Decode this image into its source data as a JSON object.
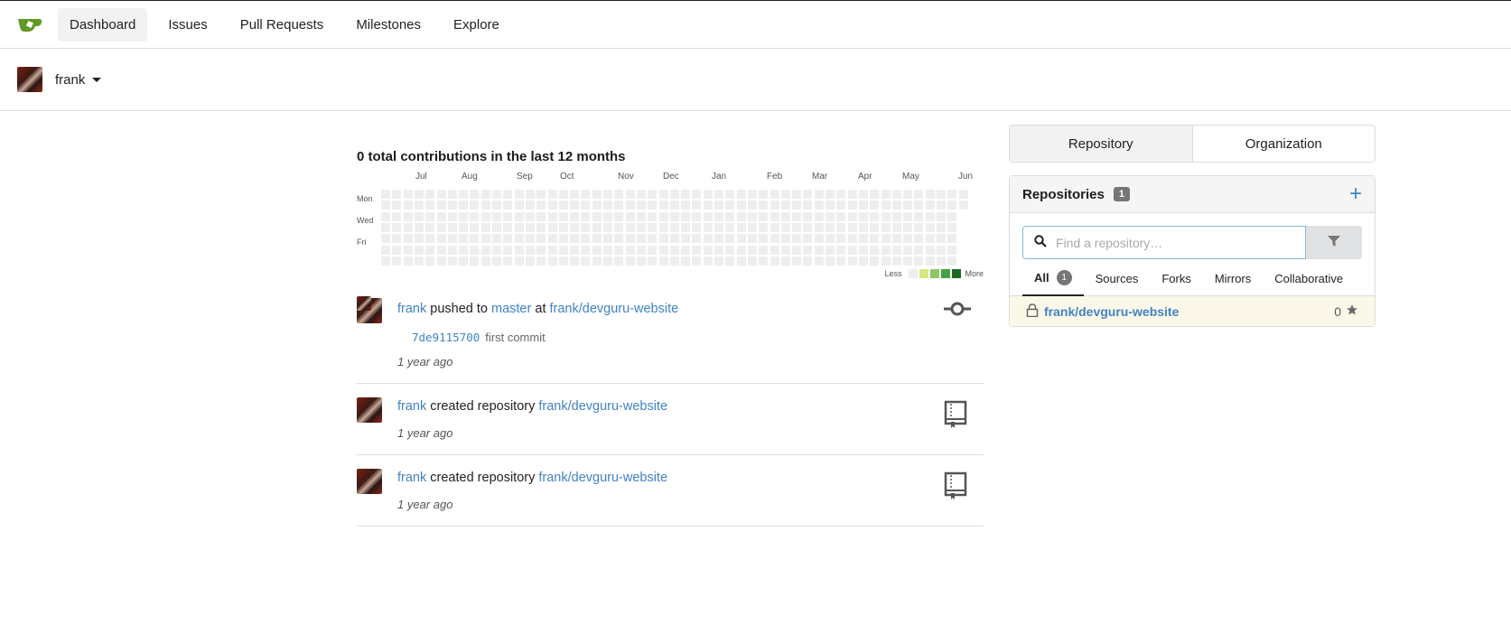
{
  "nav": {
    "items": [
      {
        "label": "Dashboard",
        "active": true
      },
      {
        "label": "Issues"
      },
      {
        "label": "Pull Requests"
      },
      {
        "label": "Milestones"
      },
      {
        "label": "Explore"
      }
    ]
  },
  "user": {
    "name": "frank"
  },
  "contributions": {
    "title": "0 total contributions in the last 12 months",
    "months": [
      "Jul",
      "Aug",
      "Sep",
      "Oct",
      "Nov",
      "Dec",
      "Jan",
      "Feb",
      "Mar",
      "Apr",
      "May",
      "Jun"
    ],
    "days": [
      "Mon",
      "Wed",
      "Fri"
    ],
    "legend_less": "Less",
    "legend_more": "More",
    "legend_colors": [
      "#eeeeee",
      "#d6e685",
      "#8cc665",
      "#44a340",
      "#1e6823"
    ]
  },
  "feed": [
    {
      "actor": "frank",
      "action": "pushed to",
      "branch": "master",
      "at": "at",
      "repo": "frank/devguru-website",
      "commit_sha": "7de9115700",
      "commit_msg": "first commit",
      "time": "1 year ago",
      "icon": "git-commit-icon"
    },
    {
      "actor": "frank",
      "action": "created repository",
      "repo": "frank/devguru-website",
      "time": "1 year ago",
      "icon": "repo-book-icon"
    },
    {
      "actor": "frank",
      "action": "created repository",
      "repo": "frank/devguru-website",
      "time": "1 year ago",
      "icon": "repo-book-icon"
    }
  ],
  "side": {
    "tabs": [
      "Repository",
      "Organization"
    ],
    "repos_title": "Repositories",
    "repos_count": "1",
    "search_placeholder": "Find a repository…",
    "filters": [
      {
        "label": "All",
        "count": "1",
        "active": true
      },
      {
        "label": "Sources"
      },
      {
        "label": "Forks"
      },
      {
        "label": "Mirrors"
      },
      {
        "label": "Collaborative"
      }
    ],
    "repos": [
      {
        "name": "frank/devguru-website",
        "stars": "0",
        "private": true
      }
    ]
  }
}
